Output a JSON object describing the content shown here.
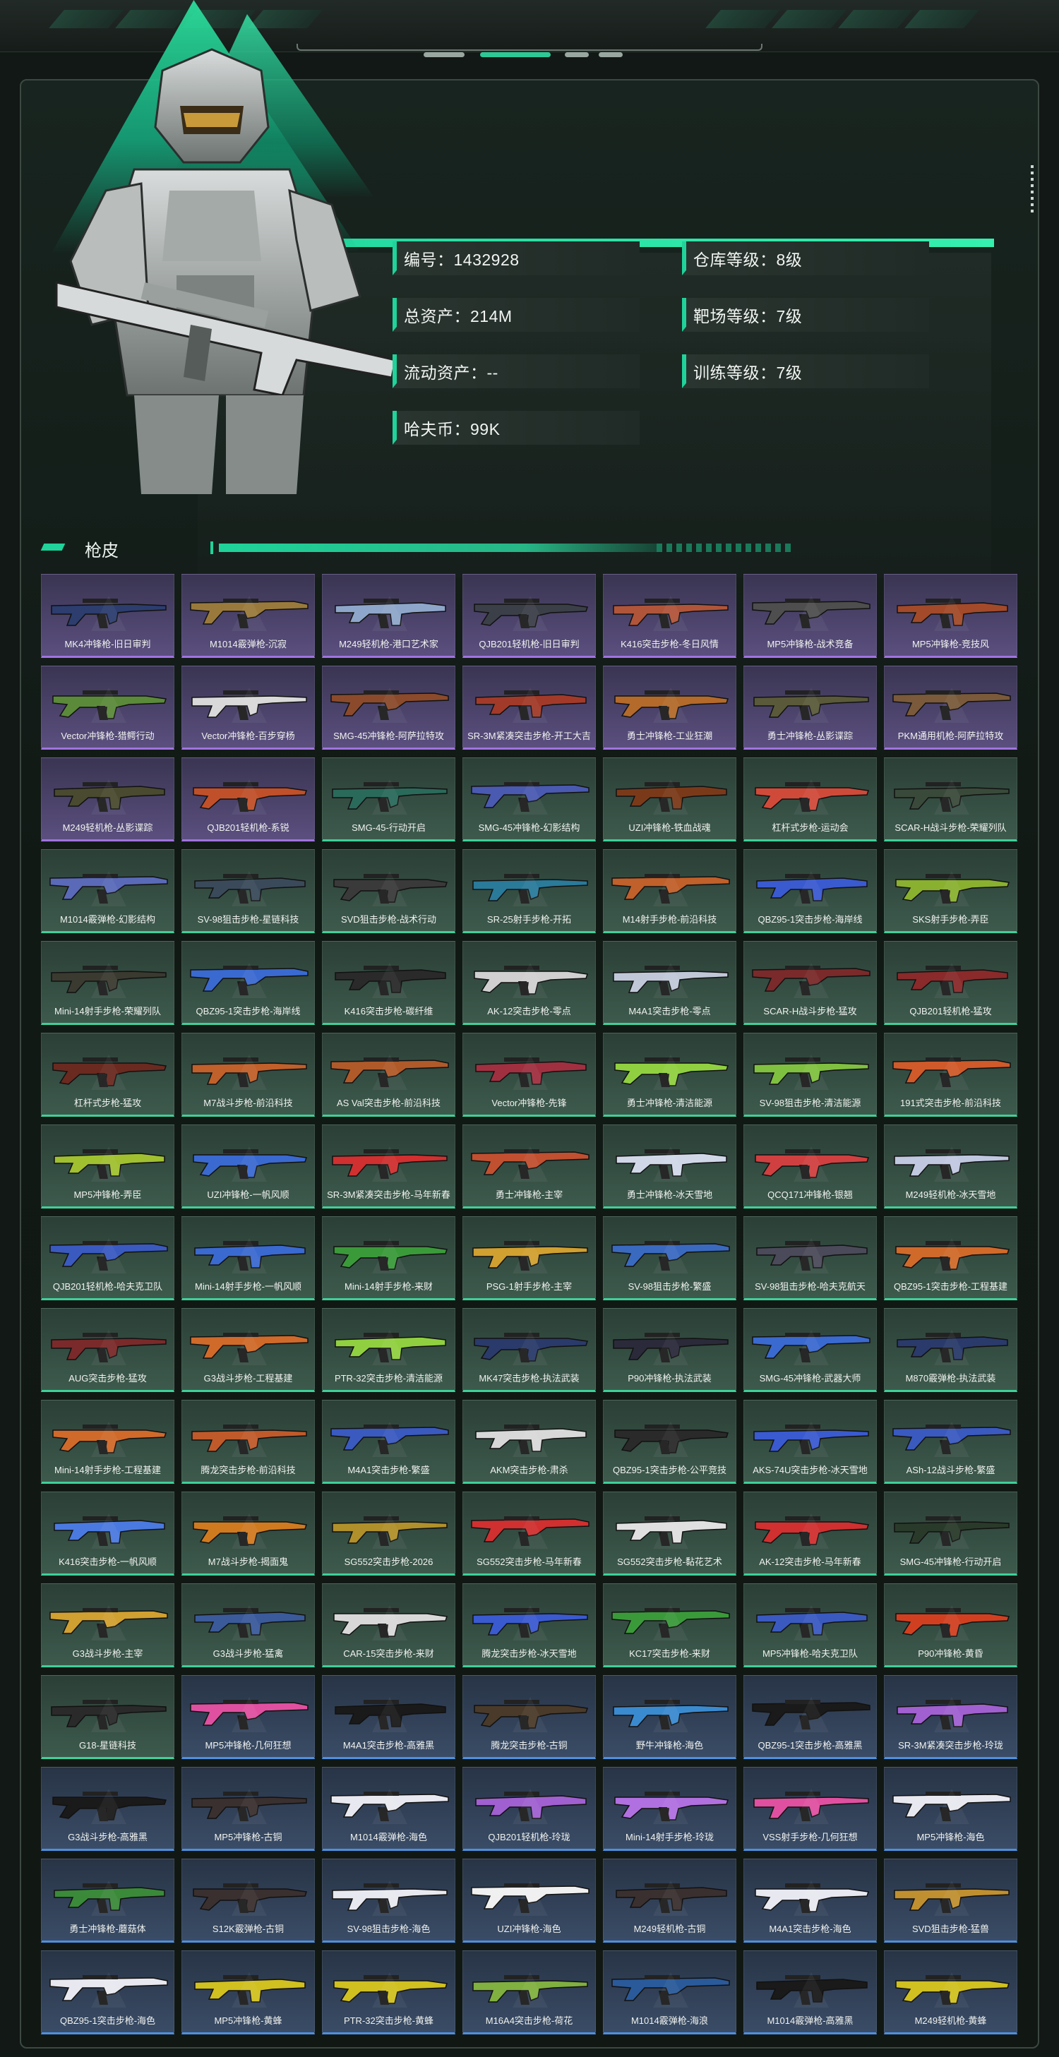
{
  "profile": {
    "id": "编号：1432928",
    "total_assets": "总资产：214M",
    "liquid_assets": "流动资产：--",
    "havoc_coin": "哈夫币：99K",
    "warehouse_level": "仓库等级：8级",
    "range_level": "靶场等级：7级",
    "training_level": "训练等级：7级"
  },
  "section": {
    "title": "枪皮"
  },
  "colors": {
    "accent": "#1fd39a",
    "purple": "#a074df",
    "green": "#3fd09a",
    "blue": "#4e8fe0"
  },
  "skins": [
    {
      "name": "MK4冲锋枪-旧日审判",
      "rarity": "purple",
      "color": "#2c3d6e"
    },
    {
      "name": "M1014霰弹枪-沉寂",
      "rarity": "purple",
      "color": "#9a7a3c"
    },
    {
      "name": "M249轻机枪-港口艺术家",
      "rarity": "purple",
      "color": "#8ea6c9"
    },
    {
      "name": "QJB201轻机枪-旧日审判",
      "rarity": "purple",
      "color": "#3b3f48"
    },
    {
      "name": "K416突击步枪-冬日风情",
      "rarity": "purple",
      "color": "#b0553a"
    },
    {
      "name": "MP5冲锋枪-战术竞备",
      "rarity": "purple",
      "color": "#4e4e4e"
    },
    {
      "name": "MP5冲锋枪-竞技风",
      "rarity": "purple",
      "color": "#a24a2a"
    },
    {
      "name": "Vector冲锋枪-猎鳄行动",
      "rarity": "purple",
      "color": "#5b8a3a"
    },
    {
      "name": "Vector冲锋枪-百步穿杨",
      "rarity": "purple",
      "color": "#d9d9d9"
    },
    {
      "name": "SMG-45冲锋枪-阿萨拉特攻",
      "rarity": "purple",
      "color": "#8b4a2c"
    },
    {
      "name": "SR-3M紧凑突击步枪-开工大吉",
      "rarity": "purple",
      "color": "#a23a2a"
    },
    {
      "name": "勇士冲锋枪-工业狂潮",
      "rarity": "purple",
      "color": "#b36a2a"
    },
    {
      "name": "勇士冲锋枪-丛影谍踪",
      "rarity": "purple",
      "color": "#5a5a3a"
    },
    {
      "name": "PKM通用机枪-阿萨拉特攻",
      "rarity": "purple",
      "color": "#7a5a3a"
    },
    {
      "name": "M249轻机枪-丛影谍踪",
      "rarity": "purple",
      "color": "#4a4a30"
    },
    {
      "name": "QJB201轻机枪-系锐",
      "rarity": "purple",
      "color": "#c0502a"
    },
    {
      "name": "SMG-45-行动开启",
      "rarity": "green",
      "color": "#2a6a5a"
    },
    {
      "name": "SMG-45冲锋枪-幻影结构",
      "rarity": "green",
      "color": "#4a5ab0"
    },
    {
      "name": "UZI冲锋枪-铁血战魂",
      "rarity": "green",
      "color": "#7a3a1a"
    },
    {
      "name": "杠杆式步枪-运动会",
      "rarity": "green",
      "color": "#d04a3a"
    },
    {
      "name": "SCAR-H战斗步枪-荣耀列队",
      "rarity": "green",
      "color": "#3a4a3a"
    },
    {
      "name": "M1014霰弹枪-幻影结构",
      "rarity": "green",
      "color": "#5a6ab8"
    },
    {
      "name": "SV-98狙击步枪-星链科技",
      "rarity": "green",
      "color": "#3a4a5a"
    },
    {
      "name": "SVD狙击步枪-战术行动",
      "rarity": "green",
      "color": "#3a3a3a"
    },
    {
      "name": "SR-25射手步枪-开拓",
      "rarity": "green",
      "color": "#2a7a9a"
    },
    {
      "name": "M14射手步枪-前沿科技",
      "rarity": "green",
      "color": "#c0602a"
    },
    {
      "name": "QBZ95-1突击步枪-海岸线",
      "rarity": "green",
      "color": "#3a5ad0"
    },
    {
      "name": "SKS射手步枪-弄臣",
      "rarity": "green",
      "color": "#8ab030"
    },
    {
      "name": "Mini-14射手步枪-荣耀列队",
      "rarity": "green",
      "color": "#3a3a30"
    },
    {
      "name": "QBZ95-1突击步枪-海岸线",
      "rarity": "green",
      "color": "#3a6ad0"
    },
    {
      "name": "K416突击步枪-碳纤维",
      "rarity": "green",
      "color": "#2a2a2a"
    },
    {
      "name": "AK-12突击步枪-零点",
      "rarity": "green",
      "color": "#d0d0d0"
    },
    {
      "name": "M4A1突击步枪-零点",
      "rarity": "green",
      "color": "#c0c8d8"
    },
    {
      "name": "SCAR-H战斗步枪-猛攻",
      "rarity": "green",
      "color": "#7a2a2a"
    },
    {
      "name": "QJB201轻机枪-猛攻",
      "rarity": "green",
      "color": "#8a2a2a"
    },
    {
      "name": "杠杆式步枪-猛攻",
      "rarity": "green",
      "color": "#6a2a20"
    },
    {
      "name": "M7战斗步枪-前沿科技",
      "rarity": "green",
      "color": "#c0602a"
    },
    {
      "name": "AS Val突击步枪-前沿科技",
      "rarity": "green",
      "color": "#b05a2a"
    },
    {
      "name": "Vector冲锋枪-先锋",
      "rarity": "green",
      "color": "#a03040"
    },
    {
      "name": "勇士冲锋枪-清洁能源",
      "rarity": "green",
      "color": "#90d040"
    },
    {
      "name": "SV-98狙击步枪-清洁能源",
      "rarity": "green",
      "color": "#80c040"
    },
    {
      "name": "191式突击步枪-前沿科技",
      "rarity": "green",
      "color": "#d05a2a"
    },
    {
      "name": "MP5冲锋枪-弄臣",
      "rarity": "green",
      "color": "#a0c030"
    },
    {
      "name": "UZI冲锋枪-一帆风顺",
      "rarity": "green",
      "color": "#3a6ad0"
    },
    {
      "name": "SR-3M紧凑突击步枪-马年新春",
      "rarity": "green",
      "color": "#d03030"
    },
    {
      "name": "勇士冲锋枪-主宰",
      "rarity": "green",
      "color": "#c05030"
    },
    {
      "name": "勇士冲锋枪-冰天雪地",
      "rarity": "green",
      "color": "#d0d8e8"
    },
    {
      "name": "QCQ171冲锋枪-银翘",
      "rarity": "green",
      "color": "#d04040"
    },
    {
      "name": "M249轻机枪-冰天雪地",
      "rarity": "green",
      "color": "#c0c8e0"
    },
    {
      "name": "QJB201轻机枪-哈夫克卫队",
      "rarity": "green",
      "color": "#3a5ac0"
    },
    {
      "name": "Mini-14射手步枪-一帆风顺",
      "rarity": "green",
      "color": "#3a6ad0"
    },
    {
      "name": "Mini-14射手步枪-来财",
      "rarity": "green",
      "color": "#3a9a3a"
    },
    {
      "name": "PSG-1射手步枪-主宰",
      "rarity": "green",
      "color": "#d0a030"
    },
    {
      "name": "SV-98狙击步枪-繁盛",
      "rarity": "green",
      "color": "#3a6ac0"
    },
    {
      "name": "SV-98狙击步枪-哈夫克航天",
      "rarity": "green",
      "color": "#4a4a5a"
    },
    {
      "name": "QBZ95-1突击步枪-工程基建",
      "rarity": "green",
      "color": "#d06a2a"
    },
    {
      "name": "AUG突击步枪-猛攻",
      "rarity": "green",
      "color": "#7a2a2a"
    },
    {
      "name": "G3战斗步枪-工程基建",
      "rarity": "green",
      "color": "#d06a2a"
    },
    {
      "name": "PTR-32突击步枪-清洁能源",
      "rarity": "green",
      "color": "#90d040"
    },
    {
      "name": "MK47突击步枪-执法武装",
      "rarity": "green",
      "color": "#2a3a6a"
    },
    {
      "name": "P90冲锋枪-执法武装",
      "rarity": "green",
      "color": "#2a2a3a"
    },
    {
      "name": "SMG-45冲锋枪-武器大师",
      "rarity": "green",
      "color": "#3a6ad0"
    },
    {
      "name": "M870霰弹枪-执法武装",
      "rarity": "green",
      "color": "#2a3a6a"
    },
    {
      "name": "Mini-14射手步枪-工程基建",
      "rarity": "green",
      "color": "#d06a2a"
    },
    {
      "name": "腾龙突击步枪-前沿科技",
      "rarity": "green",
      "color": "#c05a2a"
    },
    {
      "name": "M4A1突击步枪-繁盛",
      "rarity": "green",
      "color": "#3a5ac0"
    },
    {
      "name": "AKM突击步枪-肃杀",
      "rarity": "green",
      "color": "#d8d8d8"
    },
    {
      "name": "QBZ95-1突击步枪-公平竞技",
      "rarity": "green",
      "color": "#2a2a2a"
    },
    {
      "name": "AKS-74U突击步枪-冰天雪地",
      "rarity": "green",
      "color": "#3a5ad0"
    },
    {
      "name": "ASh-12战斗步枪-繁盛",
      "rarity": "green",
      "color": "#3a5ac0"
    },
    {
      "name": "K416突击步枪-一帆风顺",
      "rarity": "green",
      "color": "#4a7ae0"
    },
    {
      "name": "M7战斗步枪-揭面鬼",
      "rarity": "green",
      "color": "#d07a20"
    },
    {
      "name": "SG552突击步枪-2026",
      "rarity": "green",
      "color": "#b0902a"
    },
    {
      "name": "SG552突击步枪-马年新春",
      "rarity": "green",
      "color": "#d03030"
    },
    {
      "name": "SG552突击步枪-黏花艺术",
      "rarity": "green",
      "color": "#e0e0e0"
    },
    {
      "name": "AK-12突击步枪-马年新春",
      "rarity": "green",
      "color": "#d03030"
    },
    {
      "name": "SMG-45冲锋枪-行动开启",
      "rarity": "green",
      "color": "#2a3a2a"
    },
    {
      "name": "G3战斗步枪-主宰",
      "rarity": "green",
      "color": "#d0a030"
    },
    {
      "name": "G3战斗步枪-猛禽",
      "rarity": "green",
      "color": "#3a5a9a"
    },
    {
      "name": "CAR-15突击步枪-来财",
      "rarity": "green",
      "color": "#d8d8d8"
    },
    {
      "name": "腾龙突击步枪-冰天雪地",
      "rarity": "green",
      "color": "#3a5ad0"
    },
    {
      "name": "KC17突击步枪-来财",
      "rarity": "green",
      "color": "#3a9a3a"
    },
    {
      "name": "MP5冲锋枪-哈夫克卫队",
      "rarity": "green",
      "color": "#3a5ac0"
    },
    {
      "name": "P90冲锋枪-黄昏",
      "rarity": "green",
      "color": "#d04020"
    },
    {
      "name": "G18-星链科技",
      "rarity": "green",
      "color": "#2a2a2a"
    },
    {
      "name": "MP5冲锋枪-几何狂想",
      "rarity": "blue",
      "color": "#e050a0"
    },
    {
      "name": "M4A1突击步枪-高雅黑",
      "rarity": "blue",
      "color": "#1a1a1a"
    },
    {
      "name": "腾龙突击步枪-古铜",
      "rarity": "blue",
      "color": "#4a3a2a"
    },
    {
      "name": "野牛冲锋枪-海色",
      "rarity": "blue",
      "color": "#3a8ad0"
    },
    {
      "name": "QBZ95-1突击步枪-高雅黑",
      "rarity": "blue",
      "color": "#1a1a1a"
    },
    {
      "name": "SR-3M紧凑突击步枪-玲珑",
      "rarity": "blue",
      "color": "#a060d0"
    },
    {
      "name": "G3战斗步枪-高雅黑",
      "rarity": "blue",
      "color": "#1a1a1a"
    },
    {
      "name": "MP5冲锋枪-古铜",
      "rarity": "blue",
      "color": "#3a3030"
    },
    {
      "name": "M1014霰弹枪-海色",
      "rarity": "blue",
      "color": "#e8e8f0"
    },
    {
      "name": "QJB201轻机枪-玲珑",
      "rarity": "blue",
      "color": "#a060d0"
    },
    {
      "name": "Mini-14射手步枪-玲珑",
      "rarity": "blue",
      "color": "#b070e0"
    },
    {
      "name": "VSS射手步枪-几何狂想",
      "rarity": "blue",
      "color": "#e050a0"
    },
    {
      "name": "MP5冲锋枪-海色",
      "rarity": "blue",
      "color": "#e8e8f0"
    },
    {
      "name": "勇士冲锋枪-蘑菇体",
      "rarity": "blue",
      "color": "#3a8a3a"
    },
    {
      "name": "S12K霰弹枪-古铜",
      "rarity": "blue",
      "color": "#3a3030"
    },
    {
      "name": "SV-98狙击步枪-海色",
      "rarity": "blue",
      "color": "#e8e8f0"
    },
    {
      "name": "UZI冲锋枪-海色",
      "rarity": "blue",
      "color": "#f0f0f0"
    },
    {
      "name": "M249轻机枪-古铜",
      "rarity": "blue",
      "color": "#3a3030"
    },
    {
      "name": "M4A1突击步枪-海色",
      "rarity": "blue",
      "color": "#e8e8f0"
    },
    {
      "name": "SVD狙击步枪-猛兽",
      "rarity": "blue",
      "color": "#c09030"
    },
    {
      "name": "QBZ95-1突击步枪-海色",
      "rarity": "blue",
      "color": "#e8e8f0"
    },
    {
      "name": "MP5冲锋枪-黄蜂",
      "rarity": "blue",
      "color": "#d0c020"
    },
    {
      "name": "PTR-32突击步枪-黄蜂",
      "rarity": "blue",
      "color": "#d0c020"
    },
    {
      "name": "M16A4突击步枪-荷花",
      "rarity": "blue",
      "color": "#80b040"
    },
    {
      "name": "M1014霰弹枪-海浪",
      "rarity": "blue",
      "color": "#2a5a9a"
    },
    {
      "name": "M1014霰弹枪-高雅黑",
      "rarity": "blue",
      "color": "#1a1a1a"
    },
    {
      "name": "M249轻机枪-黄蜂",
      "rarity": "blue",
      "color": "#d0c020"
    }
  ]
}
